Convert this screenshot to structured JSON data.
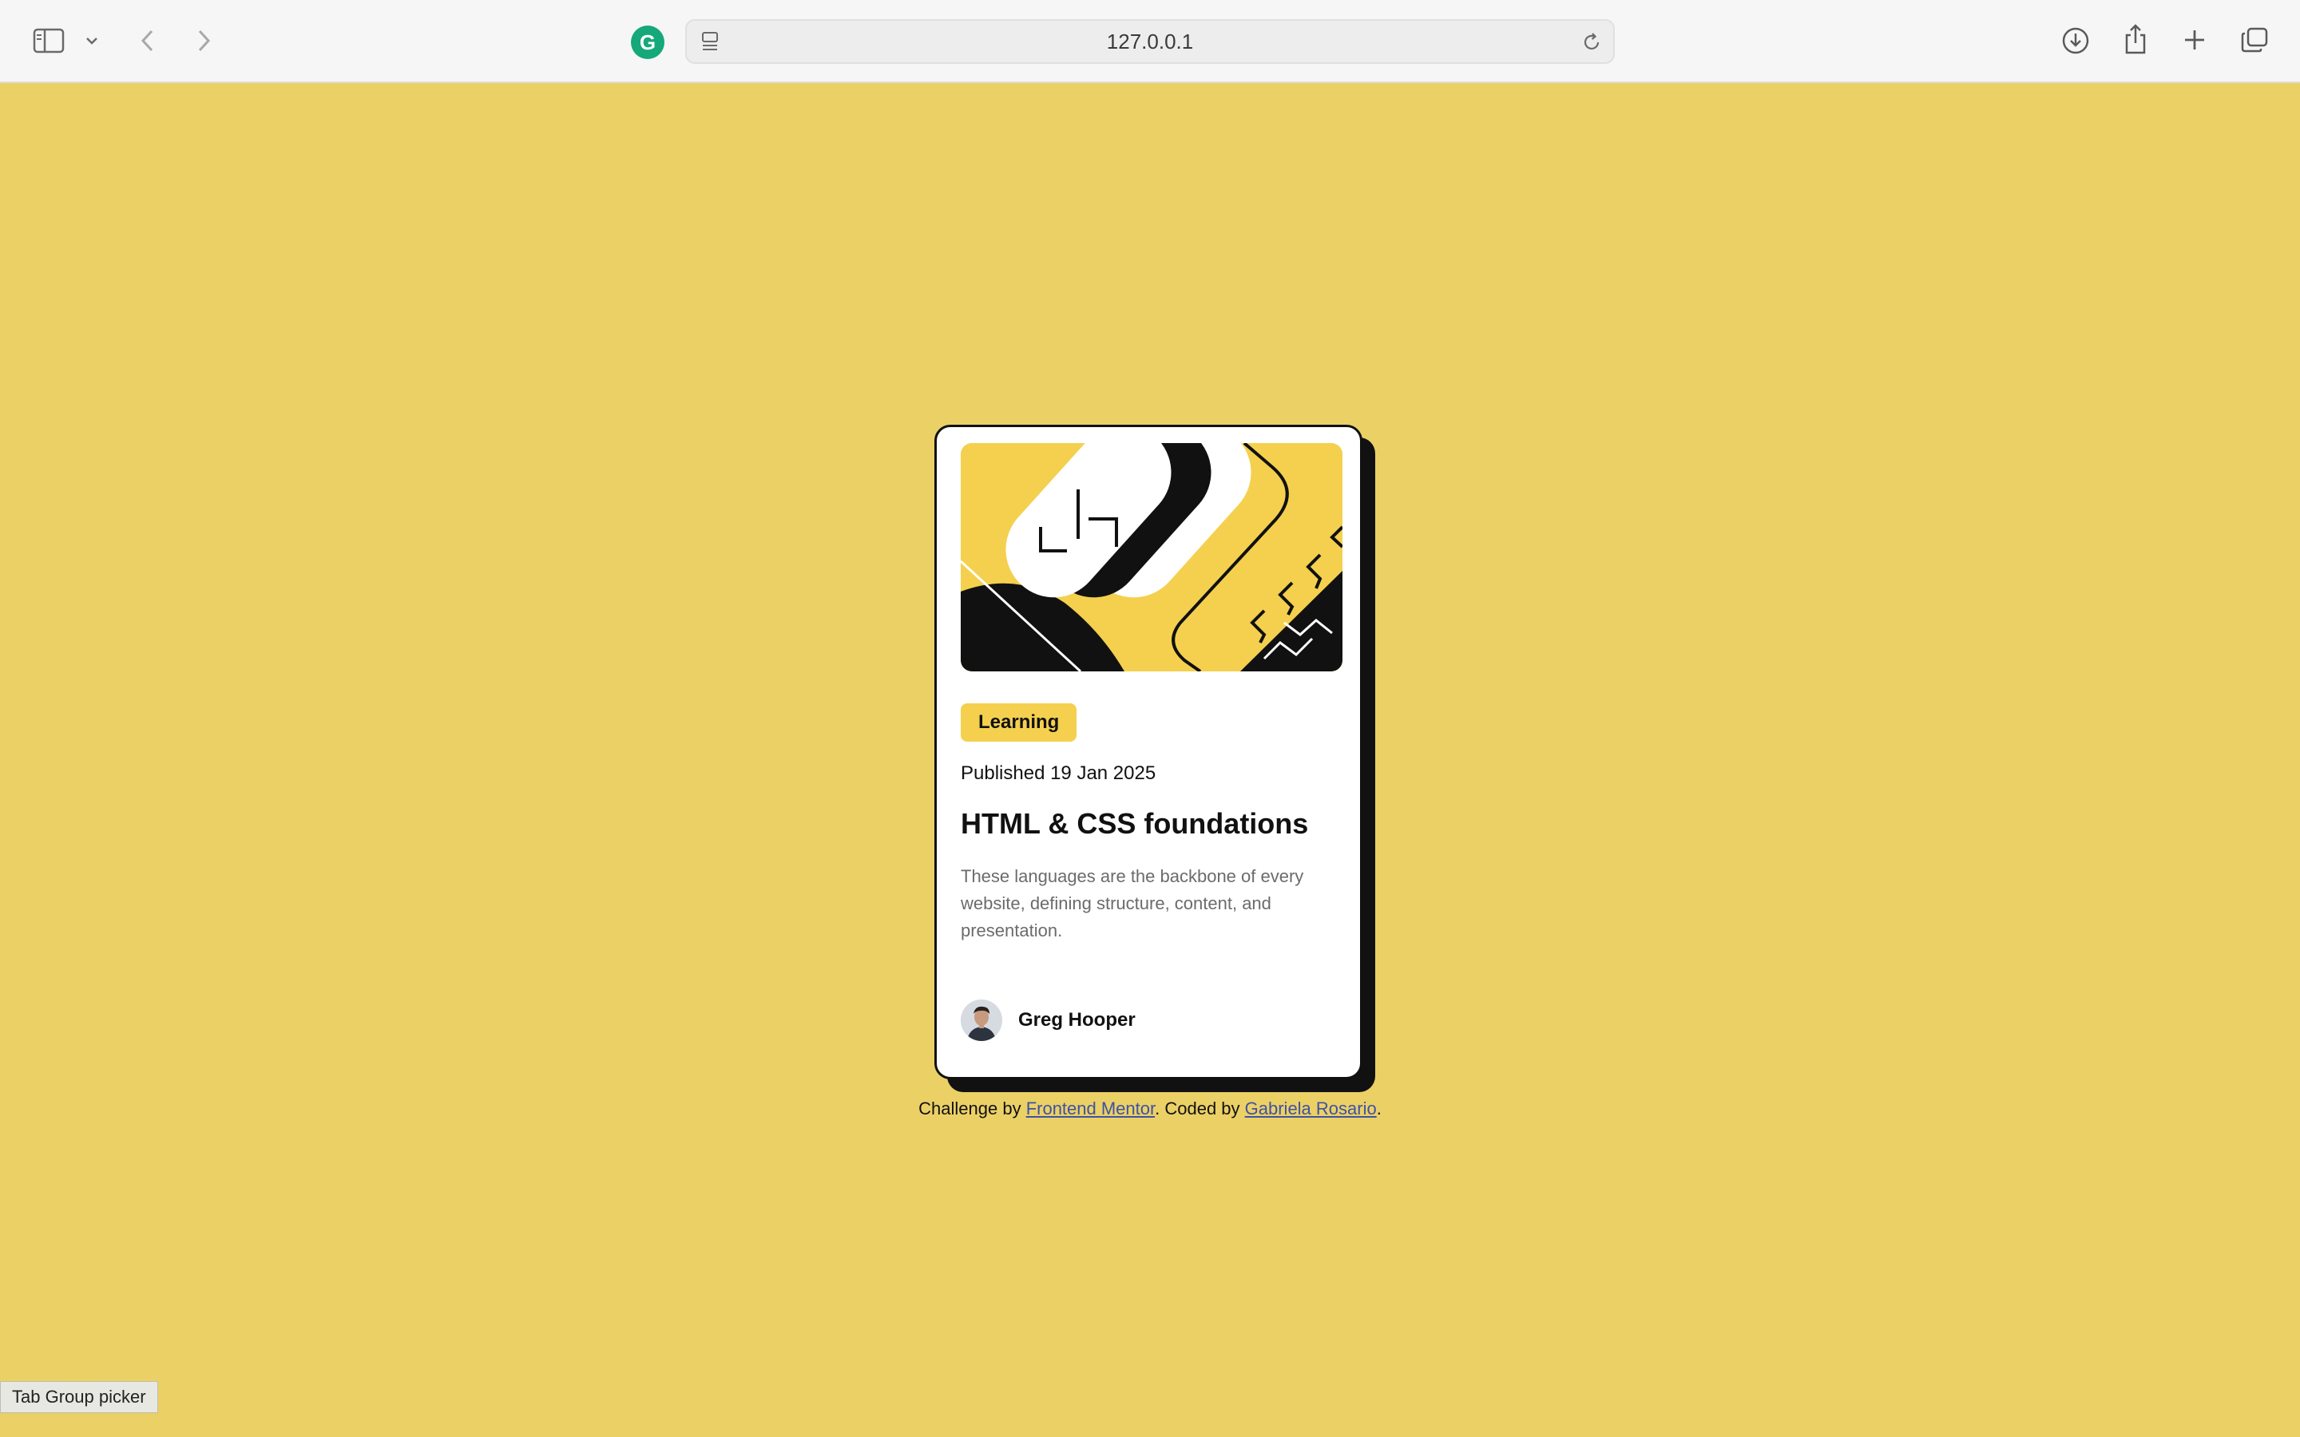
{
  "browser": {
    "url": "127.0.0.1",
    "grammarly_letter": "G"
  },
  "card": {
    "category": "Learning",
    "published": "Published 19 Jan 2025",
    "title": "HTML & CSS foundations",
    "description": "These languages are the backbone of every website, defining structure, content, and presentation.",
    "author": "Greg Hooper"
  },
  "attribution": {
    "prefix": "Challenge by ",
    "link1": "Frontend Mentor",
    "middle": ". Coded by ",
    "link2": "Gabriela Rosario",
    "suffix": "."
  },
  "tooltip": "Tab Group picker",
  "colors": {
    "page_background": "#ebd066",
    "accent_yellow": "#f4d04e",
    "ink": "#111111",
    "link": "#3e52a3"
  }
}
